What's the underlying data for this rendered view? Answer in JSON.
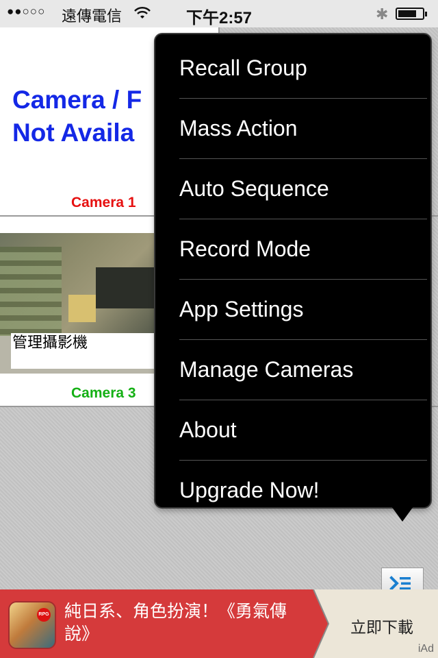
{
  "status_bar": {
    "signal": "●●○○○",
    "carrier": "遠傳電信",
    "time": "下午2:57"
  },
  "cameras": [
    {
      "label": "Camera 1",
      "message": "Camera / F\nNot Availa",
      "label_color": "#e61010"
    },
    {
      "label": "Camera 3",
      "overlay_text": "管理攝影機",
      "label_color": "#14b014"
    }
  ],
  "menu": {
    "items": [
      "Recall Group",
      "Mass Action",
      "Auto Sequence",
      "Record Mode",
      "App Settings",
      "Manage Cameras",
      "About",
      "Upgrade Now!"
    ]
  },
  "ad": {
    "text": "純日系、角色扮演！《勇氣傳說》",
    "cta": "立即下載",
    "badge": "iAd",
    "icon_badge": "RPG"
  },
  "colors": {
    "camera_not_available": "#1428e6",
    "ad_background": "#d53a3b",
    "menu_background": "#000000"
  }
}
